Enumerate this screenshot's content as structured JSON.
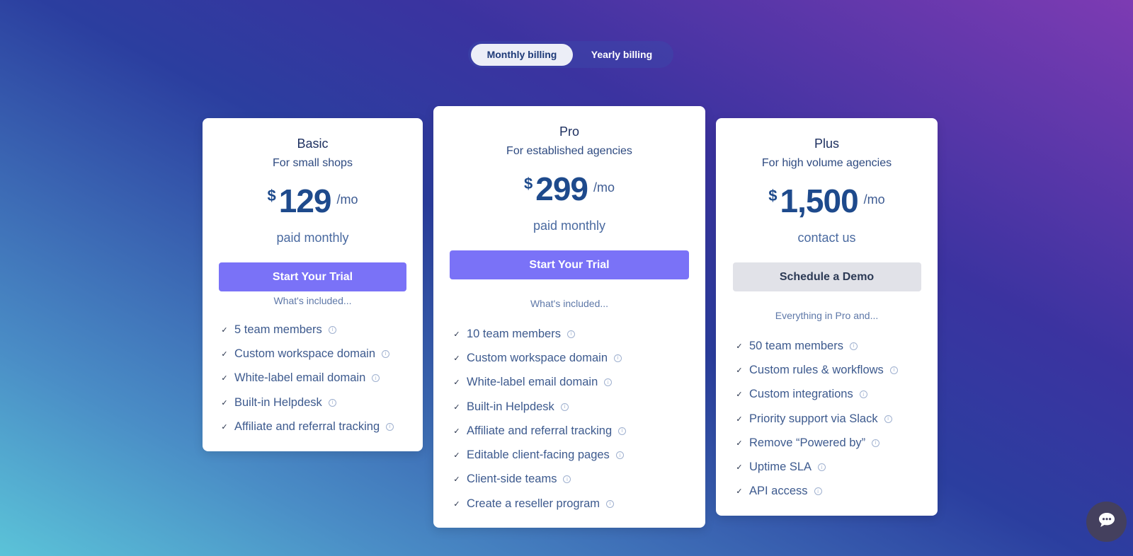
{
  "billing_toggle": {
    "options": [
      {
        "label": "Monthly billing",
        "active": true
      },
      {
        "label": "Yearly billing",
        "active": false
      }
    ]
  },
  "plans": [
    {
      "name": "Basic",
      "subtitle": "For small shops",
      "currency": "$",
      "price": "129",
      "period": "/mo",
      "billing_note": "paid monthly",
      "cta": "Start Your Trial",
      "included_heading": "What's included...",
      "features": [
        "5 team members",
        "Custom workspace domain",
        "White-label email domain",
        "Built-in Helpdesk",
        "Affiliate and referral tracking"
      ]
    },
    {
      "name": "Pro",
      "subtitle": "For established agencies",
      "currency": "$",
      "price": "299",
      "period": "/mo",
      "billing_note": "paid monthly",
      "cta": "Start Your Trial",
      "included_heading": "What's included...",
      "features": [
        "10 team members",
        "Custom workspace domain",
        "White-label email domain",
        "Built-in Helpdesk",
        "Affiliate and referral tracking",
        "Editable client-facing pages",
        "Client-side teams",
        "Create a reseller program"
      ]
    },
    {
      "name": "Plus",
      "subtitle": "For high volume agencies",
      "currency": "$",
      "price": "1,500",
      "period": "/mo",
      "billing_note": "contact us",
      "cta": "Schedule a Demo",
      "included_heading": "Everything in Pro and...",
      "features": [
        "50 team members",
        "Custom rules & workflows",
        "Custom integrations",
        "Priority support via Slack",
        "Remove “Powered by”",
        "Uptime SLA",
        "API access"
      ]
    }
  ],
  "icons": {
    "check": "✓",
    "info": "i",
    "chat": "chat-bubble"
  },
  "colors": {
    "primary_cta": "#7a72f7",
    "secondary_cta": "#e1e2e8",
    "price_text": "#1e4a8c",
    "chat_bubble_bg": "#44405e"
  }
}
